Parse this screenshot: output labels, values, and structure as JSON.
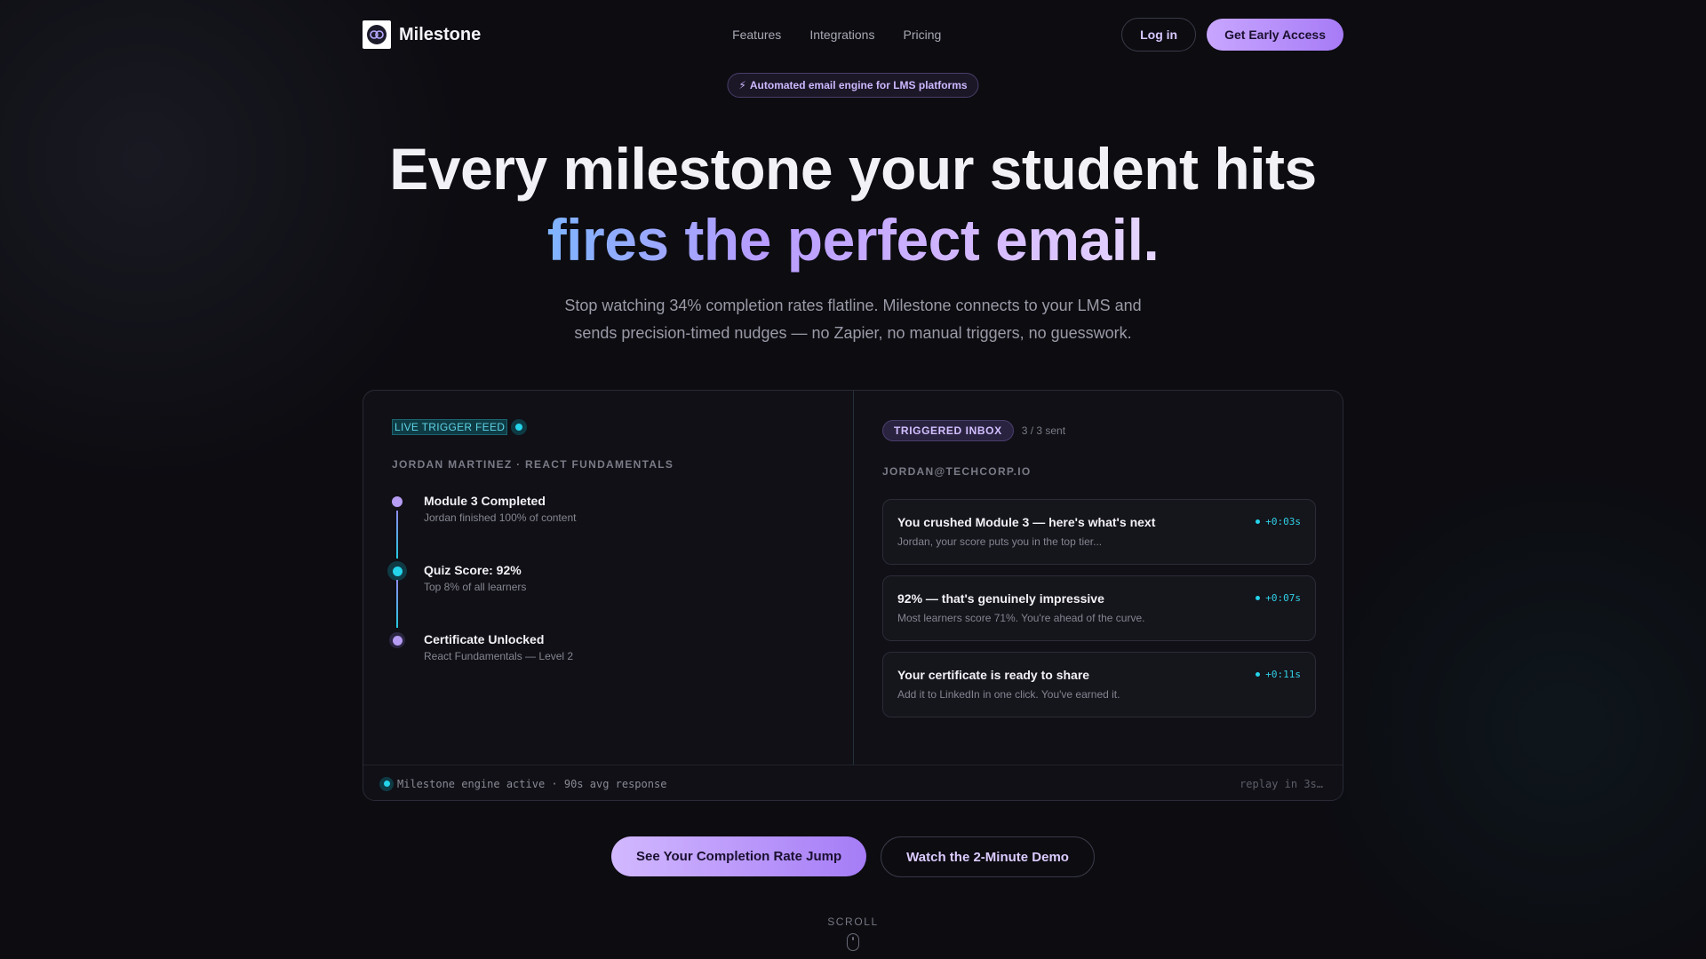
{
  "nav": {
    "brand": "Milestone",
    "links": [
      "Features",
      "Integrations",
      "Pricing"
    ],
    "login": "Log in",
    "access": "Get Early Access"
  },
  "hero": {
    "badge": "Automated email engine for LMS platforms",
    "badge_icon": "⚡",
    "headline_line1": "Every milestone your student hits",
    "headline_line2": "fires the perfect email.",
    "subtitle": "Stop watching 34% completion rates flatline. Milestone connects to your LMS and sends precision-timed nudges — no Zapier, no manual triggers, no guesswork."
  },
  "feed": {
    "label": "LIVE TRIGGER FEED",
    "student": "JORDAN MARTINEZ · REACT FUNDAMENTALS",
    "events": [
      {
        "title": "Module 3 Completed",
        "sub": "Jordan finished 100% of content"
      },
      {
        "title": "Quiz Score: 92%",
        "sub": "Top 8% of all learners"
      },
      {
        "title": "Certificate Unlocked",
        "sub": "React Fundamentals — Level 2"
      }
    ]
  },
  "inbox": {
    "label": "TRIGGERED INBOX",
    "count": "3 / 3 sent",
    "address": "JORDAN@TECHCORP.IO",
    "emails": [
      {
        "subject": "You crushed Module 3 — here's what's next",
        "preview": "Jordan, your score puts you in the top tier...",
        "time": "+0:03s"
      },
      {
        "subject": "92% — that's genuinely impressive",
        "preview": "Most learners score 71%. You're ahead of the curve.",
        "time": "+0:07s"
      },
      {
        "subject": "Your certificate is ready to share",
        "preview": "Add it to LinkedIn in one click. You've earned it.",
        "time": "+0:11s"
      }
    ]
  },
  "footer": {
    "status": "Milestone engine active · 90s avg response",
    "replay": "replay in 3s…"
  },
  "cta": {
    "primary": "See Your Completion Rate Jump",
    "secondary": "Watch the 2-Minute Demo"
  },
  "scroll": "SCROLL",
  "colors": {
    "background": "#0c0c11",
    "accent_purple": "#b69cf3",
    "accent_cyan": "#25d3ea"
  }
}
